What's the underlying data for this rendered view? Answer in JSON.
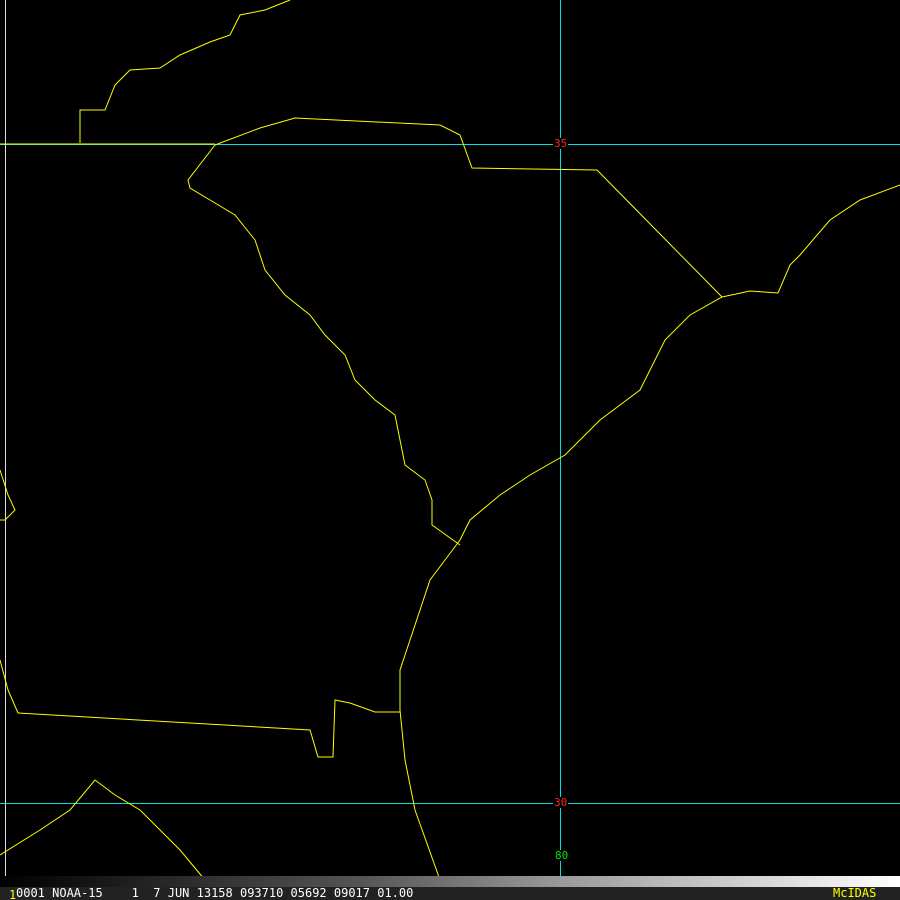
{
  "map": {
    "lat_labels": [
      "35",
      "30"
    ],
    "lon_labels": [
      "80"
    ],
    "colors": {
      "boundaries": "#ffff00",
      "graticule": "#00e0e0",
      "lat_label": "#ff2020",
      "lon_label": "#00e000"
    }
  },
  "status_bar": {
    "frame": "1",
    "text": "0001 NOAA-15    1  7 JUN 13158 093710 05692 09017 01.00",
    "brand": "McIDAS"
  }
}
